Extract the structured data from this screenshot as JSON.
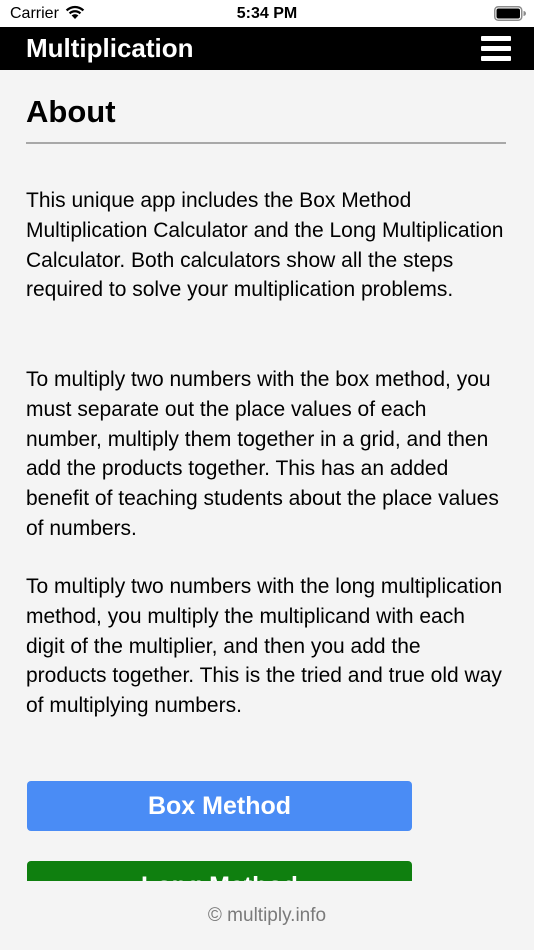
{
  "status_bar": {
    "carrier": "Carrier",
    "time": "5:34 PM"
  },
  "nav": {
    "title": "Multiplication",
    "menu_icon": "hamburger-menu-icon"
  },
  "about": {
    "title": "About",
    "paragraphs": [
      "This unique app includes the Box Method Multiplication Calculator and the Long Multiplication Calculator. Both calculators show all the steps required to solve your multiplication problems.",
      "To multiply two numbers with the box method, you must separate out the place values of each number, multiply them together in a grid, and then add the products together. This has an added benefit of teaching students about the place values of numbers.",
      "To multiply two numbers with the long multiplication method, you multiply the multiplicand with each digit of the multiplier, and then you add the products together. This is the tried and true old way of multiplying numbers."
    ]
  },
  "buttons": {
    "box_method": "Box Method",
    "long_method": "Long Method"
  },
  "footer": {
    "text": "© multiply.info"
  },
  "colors": {
    "nav_background": "#000000",
    "box_button": "#4a8cf5",
    "long_button": "#0f7f0f",
    "divider": "#a8a8a8",
    "footer_text": "#7a7a7a"
  }
}
